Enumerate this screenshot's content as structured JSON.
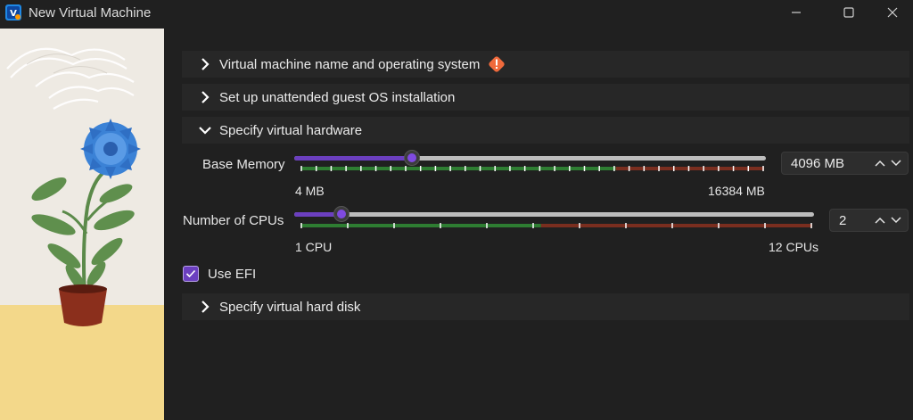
{
  "window": {
    "title": "New Virtual Machine",
    "icons": [
      "app-icon",
      "minimize-icon",
      "maximize-icon",
      "close-icon"
    ]
  },
  "sections": {
    "name_os": {
      "label": "Virtual machine name and operating system",
      "expanded": false,
      "warning_icon": "warning-icon"
    },
    "unattended": {
      "label": "Set up unattended guest OS installation",
      "expanded": false
    },
    "hardware": {
      "label": "Specify virtual hardware",
      "expanded": true
    },
    "hard_disk": {
      "label": "Specify virtual hard disk",
      "expanded": false
    }
  },
  "hardware": {
    "memory": {
      "label": "Base Memory",
      "min_label": "4 MB",
      "max_label": "16384 MB",
      "value": "4096 MB",
      "value_mb": 4096,
      "min": 4,
      "max": 16384
    },
    "cpus": {
      "label": "Number of CPUs",
      "min_label": "1 CPU",
      "max_label": "12 CPUs",
      "value": "2",
      "value_num": 2,
      "min": 1,
      "max": 12
    },
    "efi": {
      "label": "Use EFI",
      "checked": true
    }
  },
  "colors": {
    "accent": "#6b3fbf",
    "safe_zone": "#2e7d32",
    "danger_zone": "#7a2e1f",
    "warning": "#f06a3c"
  }
}
